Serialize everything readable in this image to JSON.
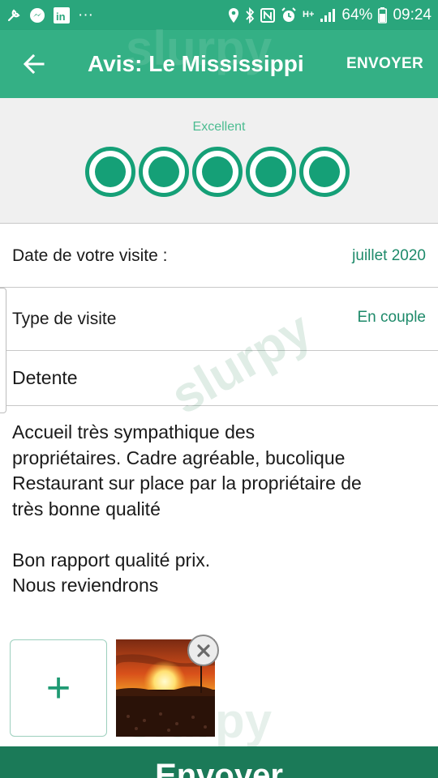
{
  "status_bar": {
    "battery_percent": "64%",
    "time": "09:24",
    "network_label": "H+",
    "dots": "···"
  },
  "header": {
    "title": "Avis: Le Mississippi",
    "send_label": "ENVOYER"
  },
  "rating": {
    "label": "Excellent",
    "value": 5,
    "max": 5
  },
  "visit": {
    "date_label": "Date de votre visite :",
    "date_value": "juillet 2020",
    "type_label": "Type de visite",
    "type_value": "En couple"
  },
  "review": {
    "title": "Detente",
    "paragraph_1": "Accueil très sympathique des\npropriétaires.  Cadre agréable, bucolique\nRestaurant sur place par la propriétaire de\ntrès bonne qualité",
    "paragraph_2": "Bon rapport qualité prix.\nNous reviendrons"
  },
  "photos": {
    "add_symbol": "+",
    "count": 1
  },
  "footer": {
    "send_label": "Envoyer"
  },
  "colors": {
    "accent": "#34b085",
    "status_bar": "#2aa67c",
    "bubble": "#15a077",
    "value_text": "#1e8a6a",
    "footer": "#1b7a58"
  },
  "watermark": {
    "brand_text": "slurpy"
  }
}
